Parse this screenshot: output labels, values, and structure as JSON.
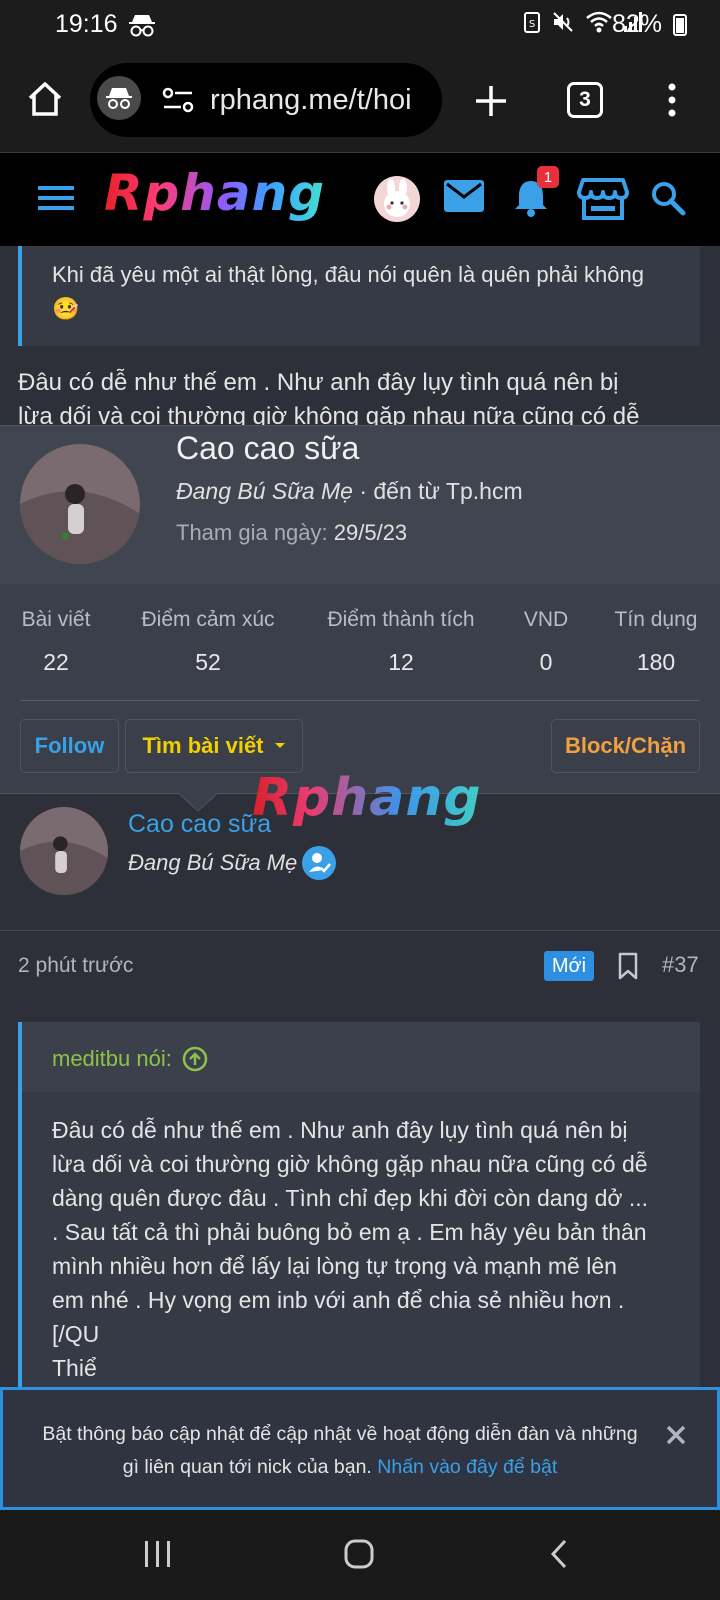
{
  "status_bar": {
    "time": "19:16",
    "battery": "82%"
  },
  "browser": {
    "url": "rphang.me/t/hoi",
    "tab_count": "3"
  },
  "site": {
    "logo": "Rphang",
    "notification_count": "1"
  },
  "post_above": {
    "quote_text": "Khi đã yêu một ai thật lòng, đâu nói quên là quên phải không 🤒",
    "body_line1": "Đâu có dễ như thế em . Như anh đây lụy tình quá nên bị",
    "body_line2": "lừa dối và coi thường giờ không gặp nhau nữa cũng có dễ"
  },
  "profile_card": {
    "name": "Cao cao sữa",
    "title": "Đang Bú Sữa Mẹ",
    "location": "· đến từ Tp.hcm",
    "joined_label": "Tham gia ngày:",
    "joined_value": "29/5/23",
    "stats": [
      {
        "label": "Bài viết",
        "value": "22"
      },
      {
        "label": "Điểm cảm xúc",
        "value": "52"
      },
      {
        "label": "Điểm thành tích",
        "value": "12"
      },
      {
        "label": "VND",
        "value": "0"
      },
      {
        "label": "Tín dụng",
        "value": "180"
      }
    ],
    "follow_label": "Follow",
    "find_posts_label": "Tìm bài viết",
    "block_label": "Block/Chặn"
  },
  "watermark": "Rphang",
  "post": {
    "author": "Cao cao sữa",
    "user_title": "Đang Bú Sữa Mẹ",
    "time": "2 phút trước",
    "new_badge": "Mới",
    "number": "#37",
    "quote_author": "meditbu nói:",
    "quote_lines": [
      "Đâu có dễ như thế em . Như anh đây lụy tình quá nên bị",
      "lừa dối và coi thường giờ không gặp nhau nữa cũng có dễ",
      "dàng quên được đâu . Tình chỉ đẹp khi đời còn dang dở ...",
      ". Sau tất cả thì phải buông bỏ em ạ . Em hãy yêu bản thân",
      "mình nhiều hơn để lấy lại lòng tự trọng và mạnh mẽ lên",
      "em nhé . Hy vọng em inb với anh để chia sẻ nhiều hơn .",
      "[/QU",
      "Thiể"
    ]
  },
  "notification": {
    "line1": "Bật thông báo cập nhật để cập nhật về hoạt động diễn đàn và những",
    "line2": "gì liên quan tới nick của bạn.",
    "link": "Nhấn vào đây để bật"
  },
  "colors": {
    "accent": "#3aa0e8",
    "badge": "#e8303a",
    "quote_author": "#8bc34a",
    "find_posts": "#f0d000",
    "block": "#f0a040"
  }
}
